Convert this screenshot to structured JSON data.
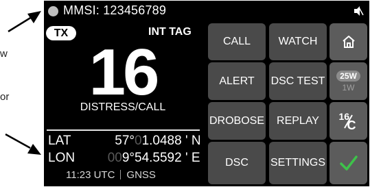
{
  "margin": {
    "partial_word_1": "w",
    "partial_word_2": "or"
  },
  "status": {
    "mmsi": "MMSI: 123456789",
    "speaker_icon": "speaker-muted-icon"
  },
  "info": {
    "tx_badge": "TX",
    "int_tag": "INT TAG",
    "channel": "16",
    "channel_name": "DISTRESS/CALL"
  },
  "position": {
    "lat_label": "LAT",
    "lat_deg_dim": "",
    "lat_deg": "57°",
    "lat_min_dim": "0",
    "lat_min": "1.0488 ' N",
    "lon_label": "LON",
    "lon_deg_dim": "00",
    "lon_deg": "9°",
    "lon_min": "54.5592 ' E",
    "time": "11:23 UTC",
    "source": "GNSS"
  },
  "buttons": {
    "call": "CALL",
    "watch": "WATCH",
    "alert": "ALERT",
    "dsc_test": "DSC TEST",
    "drobose": "DROBOSE",
    "replay": "REPLAY",
    "dsc": "DSC",
    "settings": "SETTINGS",
    "power_high": "25W",
    "power_low": "1W",
    "quick_num": "16",
    "quick_den": "C"
  },
  "colors": {
    "screen_bg": "#000000",
    "button_bg": "#4a4a4a",
    "side_button_bg": "#5c5c5c",
    "confirm_green": "#3ec24a"
  }
}
